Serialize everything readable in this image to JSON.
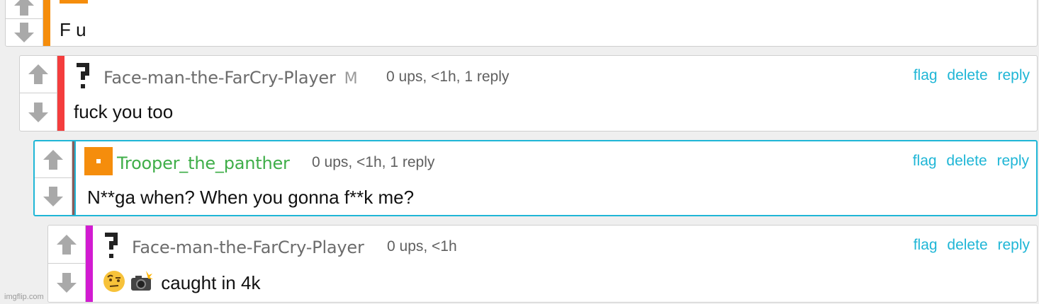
{
  "colors": {
    "link": "#1fb6d6",
    "bar_orange": "#f58d0c",
    "bar_red": "#f43d3d",
    "bar_pink": "#d21bd1",
    "highlight_border": "#1fb6d6",
    "username_green": "#3fae49"
  },
  "icons": {
    "upvote": "arrow-up-icon",
    "downvote": "arrow-down-icon",
    "question_avatar": "question-mark-icon",
    "orange_avatar": "orange-square-icon"
  },
  "comments": [
    {
      "body": "F u"
    },
    {
      "username": "Face-man-the-FarCry-Player",
      "mod_badge": "M",
      "meta": "0 ups, <1h, 1 reply",
      "actions": {
        "flag": "flag",
        "delete": "delete",
        "reply": "reply"
      },
      "body": "fuck you too"
    },
    {
      "username": "Trooper_the_panther",
      "meta": "0 ups, <1h, 1 reply",
      "actions": {
        "flag": "flag",
        "delete": "delete",
        "reply": "reply"
      },
      "body": "N**ga when? When you gonna f**k me?"
    },
    {
      "username": "Face-man-the-FarCry-Player",
      "meta": "0 ups, <1h",
      "actions": {
        "flag": "flag",
        "delete": "delete",
        "reply": "reply"
      },
      "body_emoji": "🤨📸",
      "body": "caught in 4k"
    }
  ],
  "watermark": "imgflip.com"
}
